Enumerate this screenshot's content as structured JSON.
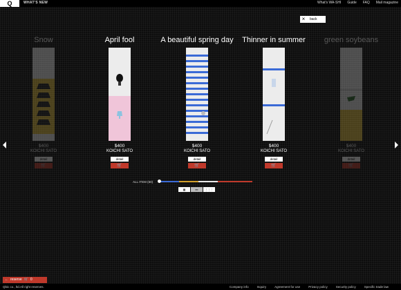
{
  "header": {
    "logo": "Q",
    "whats_new": "WHAT'S NEW",
    "nav": [
      "What's WA-SHI",
      "Guide",
      "FAQ",
      "Mail magazine"
    ]
  },
  "back_label": "back",
  "products": [
    {
      "title": "Snow",
      "price": "$400",
      "artist": "KOICHI SATO",
      "detail": "detail",
      "dimmed": true
    },
    {
      "title": "April fool",
      "price": "$400",
      "artist": "KOICHI SATO",
      "detail": "detail",
      "dimmed": false
    },
    {
      "title": "A beautiful spring day",
      "price": "$400",
      "artist": "KOICHI SATO",
      "detail": "detail",
      "dimmed": false
    },
    {
      "title": "Thinner in summer",
      "price": "$400",
      "artist": "KOICHI SATO",
      "detail": "detail",
      "dimmed": false
    },
    {
      "title": "green soybeans",
      "price": "$400",
      "artist": "KOICHI SATO",
      "detail": "detail",
      "dimmed": true
    }
  ],
  "all_item_label": "ALL ITEM (60)",
  "reserve": {
    "label": "reserve",
    "count": "0"
  },
  "footer": {
    "copyright": "Qbic co., ltd.All right reserves.",
    "links": [
      "Company info",
      "Inquiry",
      "Agreement for use",
      "Privacy policy",
      "Security policy",
      "Specific trade law"
    ]
  },
  "colors": {
    "cart": "#c0392b",
    "accent_blue": "#3a6ad6",
    "yellow_panel": "#e3bf3e",
    "pink_panel": "#f0c5d9"
  }
}
